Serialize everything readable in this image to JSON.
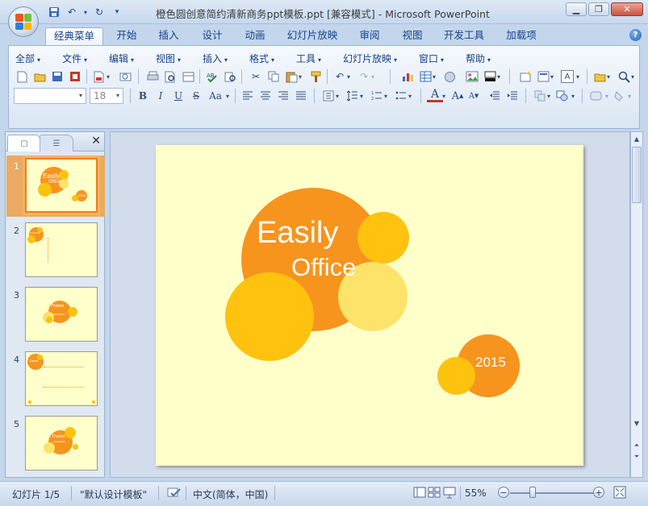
{
  "window": {
    "title": "橙色圆创意简约清新商务ppt模板.ppt [兼容模式] - Microsoft PowerPoint",
    "minimize_icon": "minimize-icon",
    "maximize_icon": "maximize-icon",
    "close_icon": "close-icon"
  },
  "tabs": [
    "经典菜单",
    "开始",
    "插入",
    "设计",
    "动画",
    "幻灯片放映",
    "审阅",
    "视图",
    "开发工具",
    "加载项"
  ],
  "menus": [
    "全部",
    "文件",
    "编辑",
    "视图",
    "插入",
    "格式",
    "工具",
    "幻灯片放映",
    "窗口",
    "帮助"
  ],
  "font_size_value": "18",
  "font_name_value": "",
  "format_buttons": {
    "bold": "B",
    "italic": "I",
    "underline": "U",
    "shadow": "S",
    "case": "Aa"
  },
  "slides": [
    {
      "number": "1",
      "title": "Easily",
      "subtitle": "Office",
      "year": "2015"
    },
    {
      "number": "2",
      "title": "Contents"
    },
    {
      "number": "3",
      "title": "Thanks",
      "subtitle": "Introduction"
    },
    {
      "number": "4",
      "title": "Detail"
    },
    {
      "number": "5",
      "title": "Thanks",
      "subtitle": "Introduction"
    }
  ],
  "slide_main": {
    "title": "Easily",
    "subtitle": "Office",
    "year": "2015",
    "colors": {
      "background": "#ffffca",
      "orange": "#f7941d",
      "yellow": "#ffc20e",
      "light_yellow": "#fde36a"
    }
  },
  "status": {
    "slide_info": "幻灯片 1/5",
    "theme": "\"默认设计模板\"",
    "language": "中文(简体，中国)",
    "zoom": "55%"
  }
}
